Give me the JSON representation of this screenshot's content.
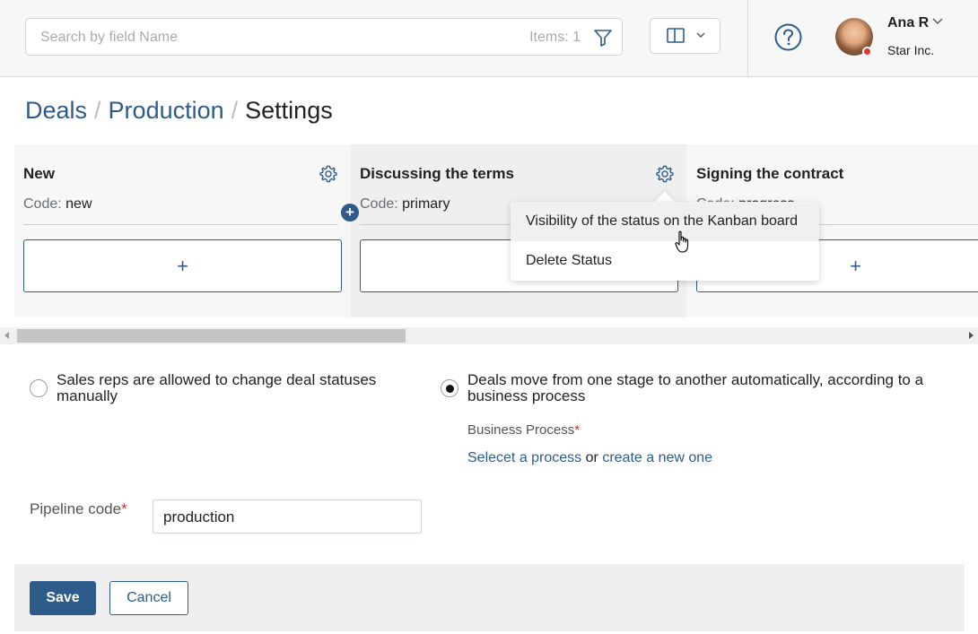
{
  "header": {
    "search_placeholder": "Search by field Name",
    "items_count": "Items: 1",
    "user_name": "Ana R",
    "user_company": "Star Inc."
  },
  "breadcrumb": {
    "items": [
      "Deals",
      "Production"
    ],
    "current": "Settings"
  },
  "kanban": {
    "code_label": "Code:",
    "add_symbol": "+",
    "columns": [
      {
        "title": "New",
        "code": "new"
      },
      {
        "title": "Discussing the terms",
        "code": "primary"
      },
      {
        "title": "Signing the contract",
        "code": "progress"
      }
    ]
  },
  "context_menu": {
    "items": [
      "Visibility of the status on the Kanban board",
      "Delete Status"
    ]
  },
  "status_mode": {
    "manual_label": "Sales reps are allowed to change deal statuses manually",
    "auto_label": "Deals move from one stage to another automatically, according to a business process",
    "selected": "auto"
  },
  "business_process": {
    "label": "Business Process",
    "required_mark": "*",
    "select_link": "Selecet a process",
    "or_text": "or",
    "create_link": "create a new one"
  },
  "pipeline": {
    "label": "Pipeline code",
    "required_mark": "*",
    "value": "production"
  },
  "footer": {
    "save_label": "Save",
    "cancel_label": "Cancel"
  },
  "colors": {
    "accent": "#2e5c8a",
    "required": "#d32f2f",
    "status_offline": "#e2362e"
  }
}
